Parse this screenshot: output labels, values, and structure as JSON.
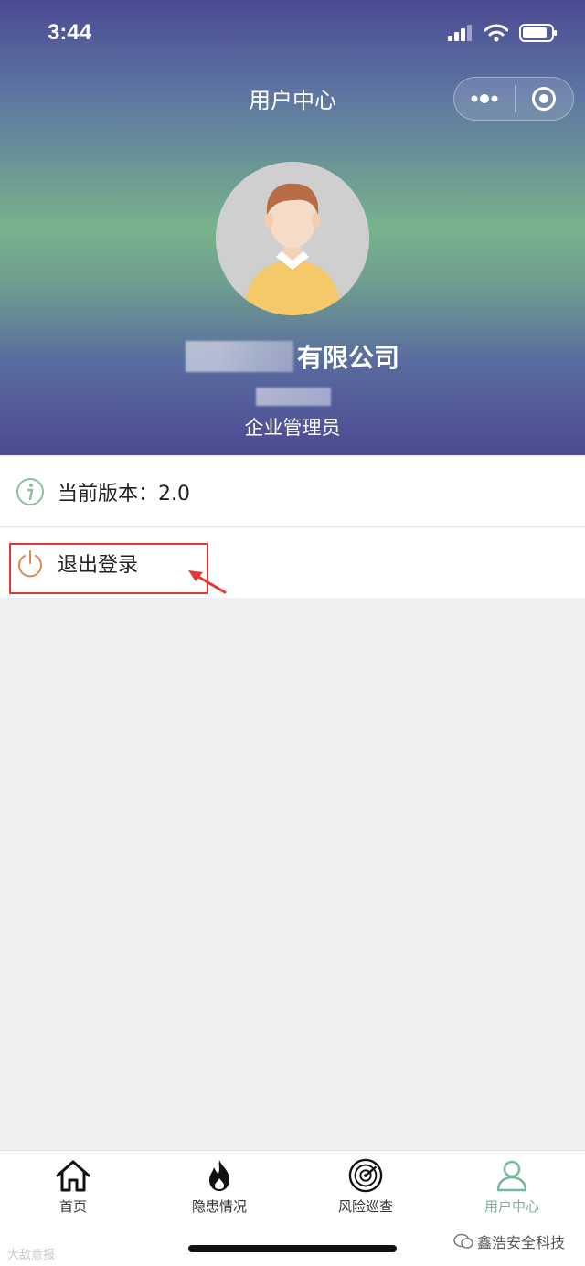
{
  "status_bar": {
    "time": "3:44"
  },
  "nav": {
    "title": "用户中心"
  },
  "profile": {
    "company_suffix": "有限公司",
    "role": "企业管理员"
  },
  "menu": {
    "version_label": "当前版本：2.0",
    "logout_label": "退出登录"
  },
  "tabbar": {
    "items": [
      {
        "label": "首页",
        "icon": "home-icon"
      },
      {
        "label": "隐患情况",
        "icon": "flame-icon"
      },
      {
        "label": "风险巡查",
        "icon": "radar-icon"
      },
      {
        "label": "用户中心",
        "icon": "user-icon"
      }
    ],
    "active_index": 3
  },
  "watermarks": {
    "left": "大敌意报",
    "right": "鑫浩安全科技"
  },
  "colors": {
    "accent": "#76b79a",
    "highlight": "#e23a32",
    "logout_icon": "#d98b56",
    "info_icon": "#8fbf9e"
  }
}
